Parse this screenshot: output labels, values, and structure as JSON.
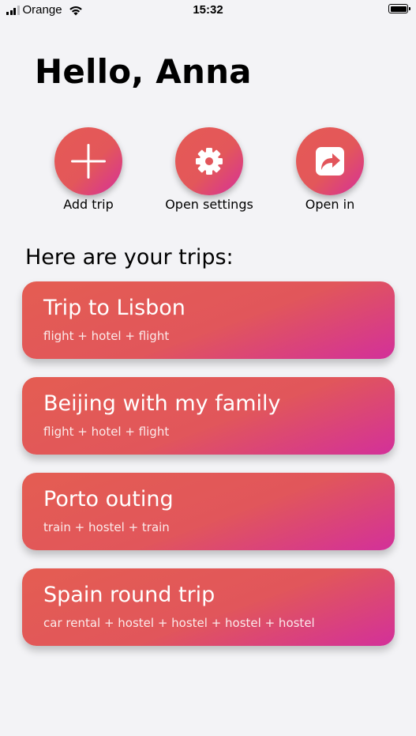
{
  "status_bar": {
    "carrier": "Orange",
    "time": "15:32",
    "icons": [
      "signal-icon",
      "wifi-icon",
      "battery-icon"
    ]
  },
  "greeting": "Hello, Anna",
  "actions": [
    {
      "label": "Add trip",
      "icon": "plus-icon"
    },
    {
      "label": "Open settings",
      "icon": "gear-icon"
    },
    {
      "label": "Open in",
      "icon": "share-icon"
    }
  ],
  "trips_heading": "Here are your trips:",
  "trips": [
    {
      "title": "Trip to Lisbon",
      "summary": "flight + hotel + flight"
    },
    {
      "title": "Beijing with my family",
      "summary": "flight + hotel + flight"
    },
    {
      "title": "Porto outing",
      "summary": "train + hostel + train"
    },
    {
      "title": "Spain round trip",
      "summary": "car rental + hostel + hostel + hostel + hostel"
    }
  ],
  "colors": {
    "background": "#f3f3f6",
    "gradient_start": "#e45d52",
    "gradient_end": "#d3309a",
    "card_text": "#ffffff"
  }
}
